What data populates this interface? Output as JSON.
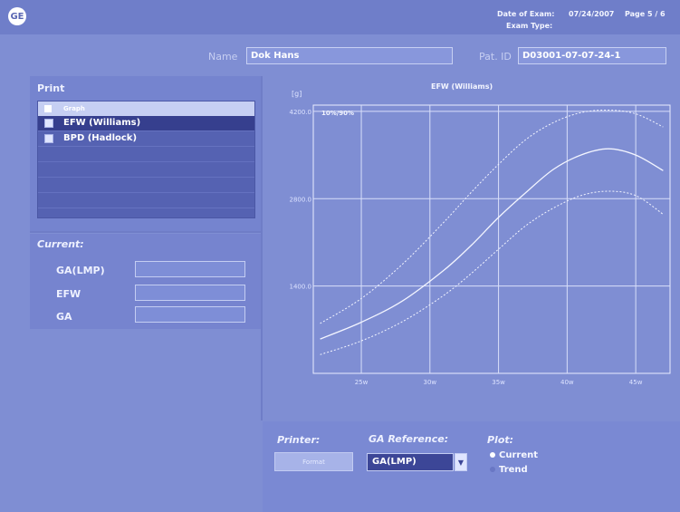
{
  "header": {
    "date_label": "Date of Exam:",
    "date_value": "07/24/2007",
    "page_label": "Page 5 / 6",
    "exam_type_label": "Exam Type:"
  },
  "patient": {
    "name_label": "Name",
    "name_value": "Dok Hans",
    "id_label": "Pat. ID",
    "id_value": "D03001-07-07-24-1"
  },
  "print": {
    "title": "Print",
    "header_label": "Graph",
    "items": [
      {
        "label": "EFW (Williams)",
        "checked": true,
        "selected": true
      },
      {
        "label": "BPD (Hadlock)",
        "checked": true,
        "selected": false
      }
    ]
  },
  "current": {
    "title": "Current:",
    "fields": [
      {
        "label": "GA(LMP)",
        "value": ""
      },
      {
        "label": "EFW",
        "value": ""
      },
      {
        "label": "GA",
        "value": ""
      }
    ]
  },
  "chart_data": {
    "type": "line",
    "title": "EFW (Williams)",
    "ylabel": "[g]",
    "annotation": "10%/90%",
    "xlim": [
      21.5,
      47.5
    ],
    "ylim": [
      0,
      4300
    ],
    "x_ticks": [
      25,
      30,
      35,
      40,
      45
    ],
    "x_tick_labels": [
      "25w",
      "30w",
      "35w",
      "40w",
      "45w"
    ],
    "y_ticks": [
      1400.0,
      2800.0,
      4200.0
    ],
    "y_tick_labels": [
      "1400.0",
      "2800.0",
      "4200.0"
    ],
    "grid": true,
    "series": [
      {
        "name": "",
        "style": "dotted",
        "x": [
          22,
          25,
          28,
          31,
          33,
          35,
          37,
          39,
          41,
          43,
          45,
          47
        ],
        "y": [
          800,
          1200,
          1750,
          2420,
          2900,
          3350,
          3750,
          4020,
          4180,
          4220,
          4160,
          3950
        ]
      },
      {
        "name": "",
        "style": "solid",
        "x": [
          22,
          25,
          28,
          31,
          33,
          35,
          37,
          39,
          41,
          43,
          45,
          47
        ],
        "y": [
          550,
          820,
          1160,
          1650,
          2050,
          2500,
          2900,
          3270,
          3500,
          3600,
          3500,
          3250
        ]
      },
      {
        "name": "",
        "style": "dotted",
        "x": [
          22,
          25,
          28,
          31,
          33,
          35,
          37,
          39,
          41,
          43,
          45,
          47
        ],
        "y": [
          300,
          520,
          830,
          1250,
          1600,
          1990,
          2370,
          2650,
          2850,
          2920,
          2850,
          2550
        ]
      }
    ]
  },
  "footer": {
    "printer_label": "Printer:",
    "printer_button": "Format",
    "ga_ref_label": "GA Reference:",
    "ga_ref_value": "GA(LMP)",
    "plot_label": "Plot:",
    "plot_options": [
      "Current",
      "Trend"
    ]
  },
  "colors": {
    "background": "#7f8ed3",
    "panel_dark": "#5562b2",
    "selected_row": "#363f8e",
    "curve": "#f3f5ff"
  }
}
